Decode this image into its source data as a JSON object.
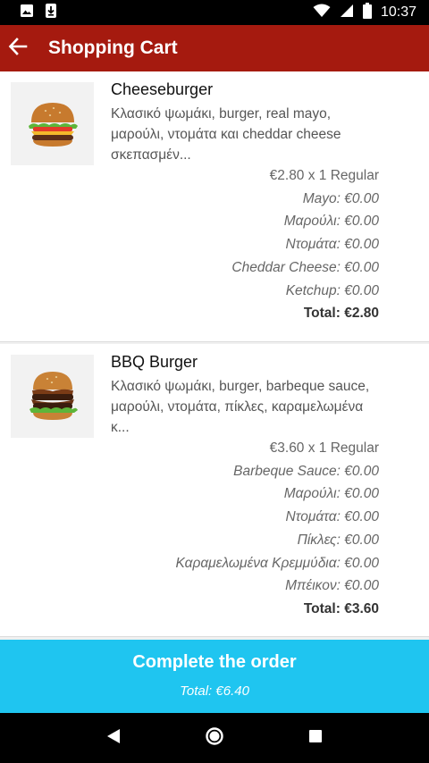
{
  "status_bar": {
    "time": "10:37",
    "icons": [
      "image-icon",
      "download-icon",
      "wifi-icon",
      "signal-icon",
      "battery-icon"
    ]
  },
  "app_bar": {
    "title": "Shopping Cart",
    "back_icon": "arrow-back-icon",
    "color": "#a51a0f"
  },
  "cart": {
    "items": [
      {
        "name": "Cheeseburger",
        "description": "Κλασικό ψωμάκι, burger, real mayo, μαρούλι, ντομάτα και cheddar cheese σκεπασμέν...",
        "price_line": "€2.80 x 1 Regular",
        "options": [
          "Mayo: €0.00",
          "Μαρούλι: €0.00",
          "Ντομάτα: €0.00",
          "Cheddar Cheese: €0.00",
          "Ketchup: €0.00"
        ],
        "total": "Total: €2.80"
      },
      {
        "name": "BBQ Burger",
        "description": "Κλασικό ψωμάκι, burger, barbeque sauce, μαρούλι, ντομάτα, πίκλες, καραμελωμένα κ...",
        "price_line": "€3.60 x 1 Regular",
        "options": [
          "Barbeque Sauce: €0.00",
          "Μαρούλι: €0.00",
          "Ντομάτα: €0.00",
          "Πίκλες: €0.00",
          "Καραμελωμένα Κρεμμύδια: €0.00",
          "Μπέικον: €0.00"
        ],
        "total": "Total: €3.60"
      }
    ]
  },
  "checkout": {
    "label": "Complete the order",
    "total": "Total: €6.40",
    "color": "#1fc5f0"
  },
  "nav_bar": {
    "icons": [
      "back-triangle-icon",
      "home-circle-icon",
      "recents-square-icon"
    ]
  }
}
